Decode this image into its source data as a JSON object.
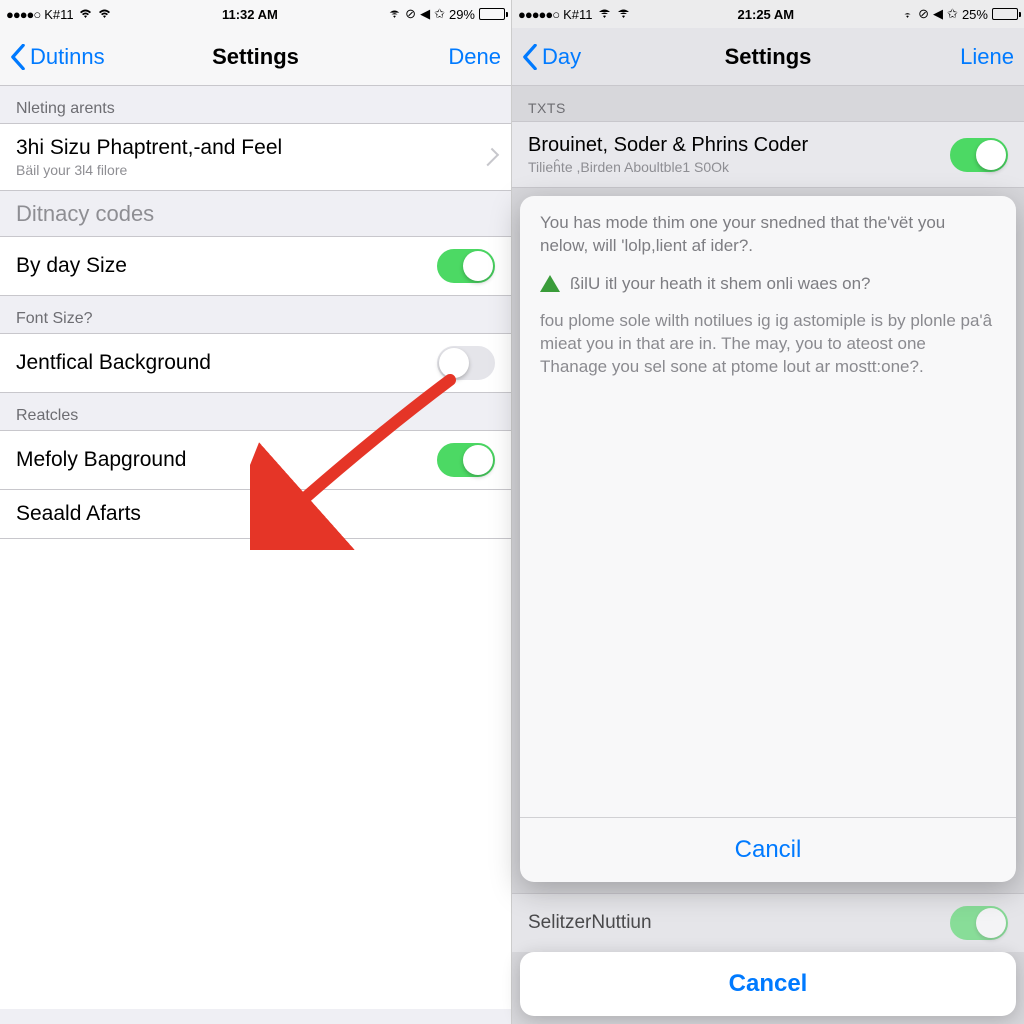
{
  "left": {
    "status": {
      "carrier": "K#11",
      "time": "11:32 AM",
      "battery_pct": "29%"
    },
    "nav": {
      "back": "Dutinns",
      "title": "Settings",
      "done": "Dene"
    },
    "sections": {
      "s1_header": "Nleting arents",
      "row1_title": "3hi Sizu Phaptrent,-and Feel",
      "row1_sub": "Bäil your 3l4 filore",
      "s2_label": "Ditnacy codes",
      "row2_title": "By day Size",
      "s3_header": "Font Size?",
      "row3_title": "Jentfical Background",
      "s4_header": "Reatcles",
      "row4_title": "Mefoly Bapground",
      "row5_title": "Seaald Afarts"
    }
  },
  "right": {
    "status": {
      "carrier": "K#11",
      "time": "21:25 AM",
      "battery_pct": "25%"
    },
    "nav": {
      "back": "Day",
      "title": "Settings",
      "done": "Liene"
    },
    "bg": {
      "header": "TXTS",
      "row_title": "Brouinet, Soder & Phrins Coder",
      "row_sub": "Tilieĥte ,Birden Aboultble1 S0Ok",
      "under_row": "SelitzerNuttiun"
    },
    "sheet": {
      "msg": "You has mode thim one your snedned that the'vёt you nelow, will 'lolp,lient af ider?.",
      "warn": "ßilU itl your heath it shem onli waes on?",
      "body": "fou plome sole wilth notilues ig ig astomiple is by plonle pa'â mieat you in that are in. The may, you to ateost one Thanage you sel sone at ptome lout ar mostt:one?.",
      "action": "Cancil",
      "cancel": "Cancel"
    }
  }
}
